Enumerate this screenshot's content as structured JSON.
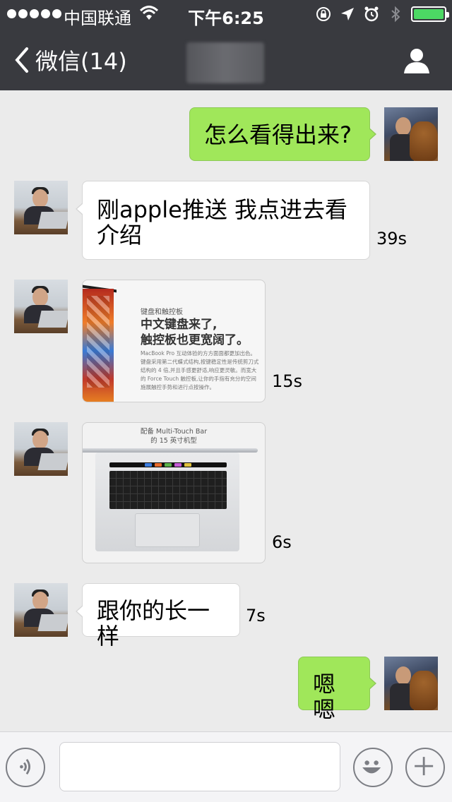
{
  "status_bar": {
    "carrier": "中国联通",
    "time": "下午6:25",
    "battery_level": 1.0
  },
  "nav": {
    "back_label": "微信(14)"
  },
  "messages": [
    {
      "side": "right",
      "type": "text",
      "text": "怎么看得出来?"
    },
    {
      "side": "left",
      "type": "voice_text",
      "text": "刚apple推送  我点进去看介绍",
      "duration": "39s"
    },
    {
      "side": "left",
      "type": "image",
      "duration": "15s",
      "image": {
        "caption": "键盘和触控板",
        "headline_line1": "中文键盘来了,",
        "headline_line2": "触控板也更宽阔了。",
        "body": "MacBook Pro 互动体验的方方面面都更加出色。键盘采用第二代蝶式结构,按键稳定性是传统剪刀式结构的 4 倍,并且手感更舒适,响应更灵敏。而宽大的 Force Touch 触控板,让你的手指有充分的空间施展触控手势和进行点按操作。"
      }
    },
    {
      "side": "left",
      "type": "image",
      "duration": "6s",
      "image": {
        "caption_line1": "配备 Multi-Touch Bar",
        "caption_line2": "的 15 英寸机型"
      }
    },
    {
      "side": "left",
      "type": "voice_text",
      "text": "跟你的长一样",
      "duration": "7s"
    },
    {
      "side": "right",
      "type": "text",
      "text": "嗯嗯"
    }
  ],
  "input_bar": {
    "placeholder": ""
  },
  "colors": {
    "nav_bg": "#393a3f",
    "chat_bg": "#ebebeb",
    "my_bubble": "#a0e75a",
    "their_bubble": "#ffffff",
    "battery_fill": "#4cd964"
  },
  "icons": [
    "signal-dots-icon",
    "wifi-icon",
    "lock-rotation-icon",
    "location-arrow-icon",
    "alarm-icon",
    "bluetooth-icon",
    "battery-icon",
    "back-chevron-icon",
    "profile-icon",
    "voice-icon",
    "emoji-icon",
    "plus-icon"
  ]
}
